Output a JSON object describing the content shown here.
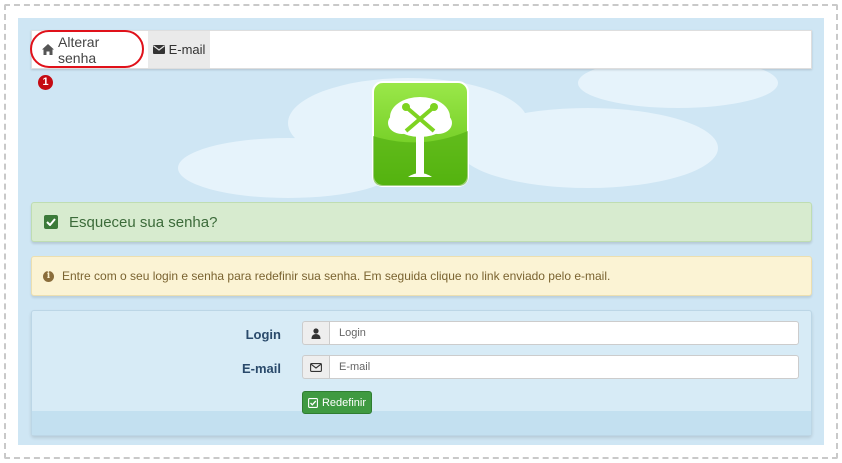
{
  "nav": {
    "tab_home_label": "Alterar senha",
    "tab_email_label": "E-mail",
    "annotation_badge": "1"
  },
  "alerts": {
    "success_text": "Esqueceu sua senha?",
    "warning_text": "Entre com o seu login e senha para redefinir sua senha. Em seguida clique no link enviado pelo e-mail."
  },
  "form": {
    "login_label": "Login",
    "login_placeholder": "Login",
    "email_label": "E-mail",
    "email_placeholder": "E-mail",
    "submit_label": "Redefinir"
  },
  "colors": {
    "page_bg": "#cfe6f4",
    "highlight": "#e0111a",
    "success_bg": "#d7ebcf",
    "warning_bg": "#fbf3d4",
    "button": "#3f9a41",
    "logo_green": "#7ed321"
  },
  "icons": {
    "home": "home-icon",
    "email": "envelope-icon",
    "check": "check-square-icon",
    "info": "info-circle-icon",
    "user": "user-icon",
    "envelope_field": "envelope-outline-icon",
    "submit": "edit-check-icon"
  }
}
